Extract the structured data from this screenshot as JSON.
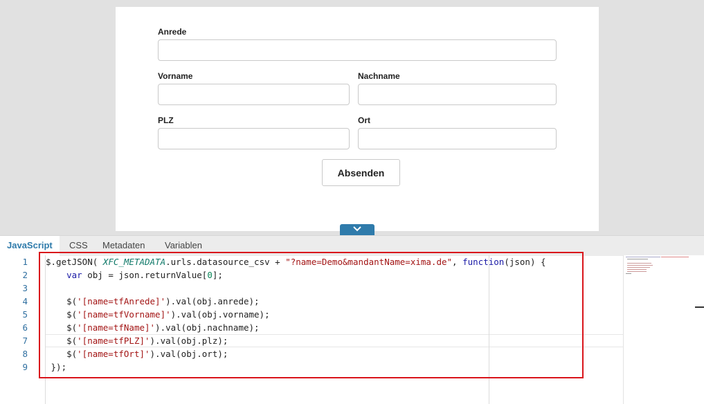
{
  "form": {
    "fields": [
      {
        "name": "anrede",
        "label": "Anrede",
        "value": ""
      },
      {
        "name": "vorname",
        "label": "Vorname",
        "value": ""
      },
      {
        "name": "nachname",
        "label": "Nachname",
        "value": ""
      },
      {
        "name": "plz",
        "label": "PLZ",
        "value": ""
      },
      {
        "name": "ort",
        "label": "Ort",
        "value": ""
      }
    ],
    "submit_label": "Absenden",
    "toggle_icon": "chevron-down-icon"
  },
  "editor": {
    "tabs": [
      {
        "label": "JavaScript",
        "active": true
      },
      {
        "label": "CSS",
        "active": false
      },
      {
        "label": "Metadaten",
        "active": false
      },
      {
        "label": "Variablen",
        "active": false
      }
    ],
    "line_numbers": [
      "1",
      "2",
      "3",
      "4",
      "5",
      "6",
      "7",
      "8",
      "9"
    ],
    "code": {
      "l1_a": "$.getJSON( ",
      "l1_b": "XFC_METADATA",
      "l1_c": ".urls.datasource_csv + ",
      "l1_d": "\"?name=Demo&mandantName=xima.de\"",
      "l1_e": ", ",
      "l1_f": "function",
      "l1_g": "(json) {",
      "l2_a": "    ",
      "l2_b": "var",
      "l2_c": " obj = json.returnValue[",
      "l2_d": "0",
      "l2_e": "];",
      "l4_a": "    $(",
      "l4_b": "'[name=tfAnrede]'",
      "l4_c": ").val(obj.anrede);",
      "l5_a": "    $(",
      "l5_b": "'[name=tfVorname]'",
      "l5_c": ").val(obj.vorname);",
      "l6_a": "    $(",
      "l6_b": "'[name=tfName]'",
      "l6_c": ").val(obj.nachname);",
      "l7_a": "    $(",
      "l7_b": "'[name=tfPLZ]'",
      "l7_c": ").val(obj.plz);",
      "l8_a": "    $(",
      "l8_b": "'[name=tfOrt]'",
      "l8_c": ").val(obj.ort);",
      "l9": " });"
    },
    "highlight_color": "#d9141b",
    "accent_color": "#2f7bab"
  }
}
